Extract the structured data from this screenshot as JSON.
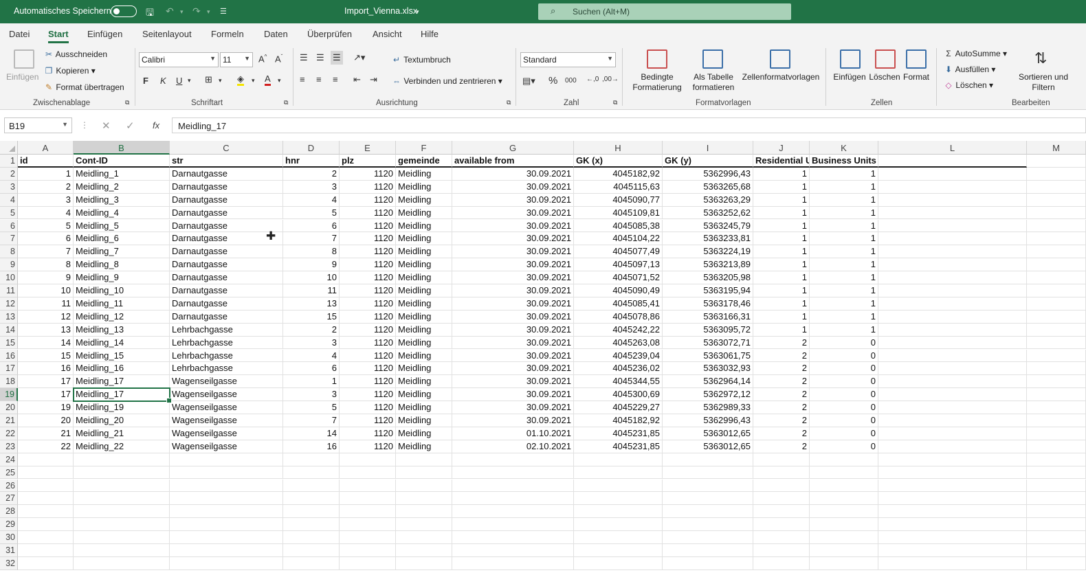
{
  "titlebar": {
    "autosave_label": "Automatisches Speichern",
    "filename": "Import_Vienna.xlsx",
    "search_placeholder": "Suchen (Alt+M)"
  },
  "menu_tabs": [
    "Datei",
    "Start",
    "Einfügen",
    "Seitenlayout",
    "Formeln",
    "Daten",
    "Überprüfen",
    "Ansicht",
    "Hilfe"
  ],
  "ribbon": {
    "clipboard": {
      "group": "Zwischenablage",
      "paste": "Einfügen",
      "cut": "Ausschneiden",
      "copy": "Kopieren",
      "format_painter": "Format übertragen"
    },
    "font": {
      "group": "Schriftart",
      "font_name": "Calibri",
      "font_size": "11",
      "bold": "F",
      "italic": "K",
      "underline": "U"
    },
    "alignment": {
      "group": "Ausrichtung",
      "wrap": "Textumbruch",
      "merge": "Verbinden und zentrieren"
    },
    "number": {
      "group": "Zahl",
      "format": "Standard"
    },
    "styles": {
      "group": "Formatvorlagen",
      "conditional": "Bedingte Formatierung",
      "as_table": "Als Tabelle formatieren",
      "cell_styles": "Zellenformatvorlagen"
    },
    "cells": {
      "group": "Zellen",
      "insert": "Einfügen",
      "delete": "Löschen",
      "format": "Format"
    },
    "editing": {
      "group": "Bearbeiten",
      "autosum": "AutoSumme",
      "fill": "Ausfüllen",
      "clear": "Löschen",
      "sort": "Sortieren und Filtern"
    }
  },
  "formula_bar": {
    "name_box": "B19",
    "fx": "fx",
    "content": "Meidling_17"
  },
  "columns": [
    "A",
    "B",
    "C",
    "D",
    "E",
    "F",
    "G",
    "H",
    "I",
    "J",
    "K",
    "L",
    "M"
  ],
  "header_row": [
    "id",
    "Cont-ID",
    "str",
    "hnr",
    "plz",
    "gemeinde",
    "available from",
    "GK (x)",
    "GK (y)",
    "Residential U",
    "Business Units"
  ],
  "rows": [
    [
      "1",
      "Meidling_1",
      "Darnautgasse",
      "2",
      "1120",
      "Meidling",
      "30.09.2021",
      "4045182,92",
      "5362996,43",
      "1",
      "1"
    ],
    [
      "2",
      "Meidling_2",
      "Darnautgasse",
      "3",
      "1120",
      "Meidling",
      "30.09.2021",
      "4045115,63",
      "5363265,68",
      "1",
      "1"
    ],
    [
      "3",
      "Meidling_3",
      "Darnautgasse",
      "4",
      "1120",
      "Meidling",
      "30.09.2021",
      "4045090,77",
      "5363263,29",
      "1",
      "1"
    ],
    [
      "4",
      "Meidling_4",
      "Darnautgasse",
      "5",
      "1120",
      "Meidling",
      "30.09.2021",
      "4045109,81",
      "5363252,62",
      "1",
      "1"
    ],
    [
      "5",
      "Meidling_5",
      "Darnautgasse",
      "6",
      "1120",
      "Meidling",
      "30.09.2021",
      "4045085,38",
      "5363245,79",
      "1",
      "1"
    ],
    [
      "6",
      "Meidling_6",
      "Darnautgasse",
      "7",
      "1120",
      "Meidling",
      "30.09.2021",
      "4045104,22",
      "5363233,81",
      "1",
      "1"
    ],
    [
      "7",
      "Meidling_7",
      "Darnautgasse",
      "8",
      "1120",
      "Meidling",
      "30.09.2021",
      "4045077,49",
      "5363224,19",
      "1",
      "1"
    ],
    [
      "8",
      "Meidling_8",
      "Darnautgasse",
      "9",
      "1120",
      "Meidling",
      "30.09.2021",
      "4045097,13",
      "5363213,89",
      "1",
      "1"
    ],
    [
      "9",
      "Meidling_9",
      "Darnautgasse",
      "10",
      "1120",
      "Meidling",
      "30.09.2021",
      "4045071,52",
      "5363205,98",
      "1",
      "1"
    ],
    [
      "10",
      "Meidling_10",
      "Darnautgasse",
      "11",
      "1120",
      "Meidling",
      "30.09.2021",
      "4045090,49",
      "5363195,94",
      "1",
      "1"
    ],
    [
      "11",
      "Meidling_11",
      "Darnautgasse",
      "13",
      "1120",
      "Meidling",
      "30.09.2021",
      "4045085,41",
      "5363178,46",
      "1",
      "1"
    ],
    [
      "12",
      "Meidling_12",
      "Darnautgasse",
      "15",
      "1120",
      "Meidling",
      "30.09.2021",
      "4045078,86",
      "5363166,31",
      "1",
      "1"
    ],
    [
      "13",
      "Meidling_13",
      "Lehrbachgasse",
      "2",
      "1120",
      "Meidling",
      "30.09.2021",
      "4045242,22",
      "5363095,72",
      "1",
      "1"
    ],
    [
      "14",
      "Meidling_14",
      "Lehrbachgasse",
      "3",
      "1120",
      "Meidling",
      "30.09.2021",
      "4045263,08",
      "5363072,71",
      "2",
      "0"
    ],
    [
      "15",
      "Meidling_15",
      "Lehrbachgasse",
      "4",
      "1120",
      "Meidling",
      "30.09.2021",
      "4045239,04",
      "5363061,75",
      "2",
      "0"
    ],
    [
      "16",
      "Meidling_16",
      "Lehrbachgasse",
      "6",
      "1120",
      "Meidling",
      "30.09.2021",
      "4045236,02",
      "5363032,93",
      "2",
      "0"
    ],
    [
      "17",
      "Meidling_17",
      "Wagenseilgasse",
      "1",
      "1120",
      "Meidling",
      "30.09.2021",
      "4045344,55",
      "5362964,14",
      "2",
      "0"
    ],
    [
      "17",
      "Meidling_17",
      "Wagenseilgasse",
      "3",
      "1120",
      "Meidling",
      "30.09.2021",
      "4045300,69",
      "5362972,12",
      "2",
      "0"
    ],
    [
      "19",
      "Meidling_19",
      "Wagenseilgasse",
      "5",
      "1120",
      "Meidling",
      "30.09.2021",
      "4045229,27",
      "5362989,33",
      "2",
      "0"
    ],
    [
      "20",
      "Meidling_20",
      "Wagenseilgasse",
      "7",
      "1120",
      "Meidling",
      "30.09.2021",
      "4045182,92",
      "5362996,43",
      "2",
      "0"
    ],
    [
      "21",
      "Meidling_21",
      "Wagenseilgasse",
      "14",
      "1120",
      "Meidling",
      "01.10.2021",
      "4045231,85",
      "5363012,65",
      "2",
      "0"
    ],
    [
      "22",
      "Meidling_22",
      "Wagenseilgasse",
      "16",
      "1120",
      "Meidling",
      "02.10.2021",
      "4045231,85",
      "5363012,65",
      "2",
      "0"
    ]
  ],
  "row_numbers": [
    "1",
    "2",
    "3",
    "4",
    "5",
    "6",
    "7",
    "8",
    "9",
    "10",
    "11",
    "12",
    "13",
    "14",
    "15",
    "16",
    "17",
    "18",
    "19",
    "20",
    "21",
    "22",
    "23",
    "24",
    "25",
    "26",
    "27",
    "28",
    "29",
    "30",
    "31",
    "32"
  ],
  "selected_cell": "B19",
  "colors": {
    "accent": "#217346",
    "search_bg": "#a9d1b8"
  }
}
